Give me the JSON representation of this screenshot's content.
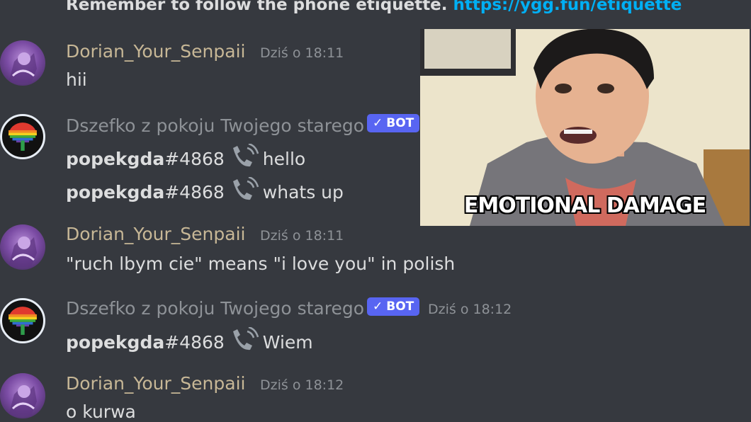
{
  "top_notice": {
    "text": "Remember to follow the phone etiquette.",
    "link": "https://ygg.fun/etiquette"
  },
  "overlay": {
    "caption": "EMOTIONAL DAMAGE"
  },
  "messages": [
    {
      "author": "Dorian_Your_Senpaii",
      "timestamp": "Dziś o 18:11",
      "lines": [
        "hii"
      ]
    },
    {
      "author": "Dszefko z pokoju Twojego starego",
      "badge": "BOT",
      "lines": [
        {
          "user": "popekgda",
          "discriminator": "#4868",
          "text": "hello"
        },
        {
          "user": "popekgda",
          "discriminator": "#4868",
          "text": "whats up"
        }
      ]
    },
    {
      "author": "Dorian_Your_Senpaii",
      "timestamp": "Dziś o 18:11",
      "lines": [
        "\"ruch lbym cie\" means \"i love you\" in polish"
      ]
    },
    {
      "author": "Dszefko z pokoju Twojego starego",
      "badge": "BOT",
      "timestamp": "Dziś o 18:12",
      "lines": [
        {
          "user": "popekgda",
          "discriminator": "#4868",
          "text": "Wiem"
        }
      ]
    },
    {
      "author": "Dorian_Your_Senpaii",
      "timestamp": "Dziś o 18:12",
      "lines": [
        "o kurwa"
      ]
    }
  ],
  "colors": {
    "background": "#36393f",
    "author_name": "#c7b796",
    "bot_name": "#8e9297",
    "badge": "#5865f2",
    "link": "#00aff4"
  },
  "icons": [
    "phone-icon",
    "check-icon"
  ]
}
